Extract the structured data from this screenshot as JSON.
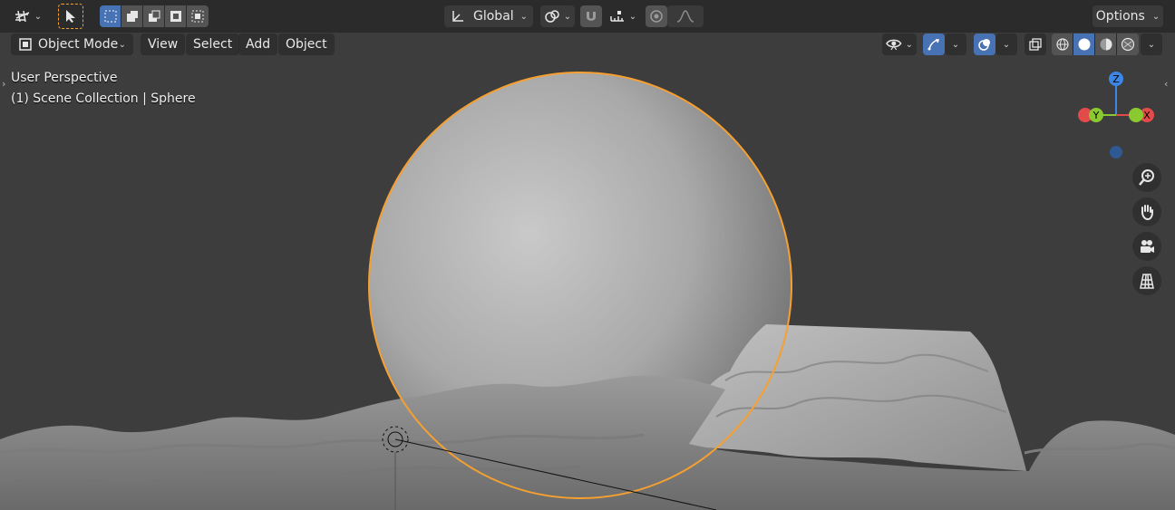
{
  "header": {
    "transform_orientation": "Global",
    "options_label": "Options"
  },
  "menubar": {
    "mode_label": "Object Mode",
    "menus": [
      "View",
      "Select",
      "Add",
      "Object"
    ]
  },
  "viewport": {
    "perspective_label": "User Perspective",
    "collection_label": "(1) Scene Collection | Sphere"
  },
  "gizmo": {
    "z_label": "Z",
    "y_label": "Y",
    "x_label": "X",
    "x_color": "#e34a4a",
    "y_color": "#8bc931",
    "z_color": "#3c87e6"
  },
  "colors": {
    "accent": "#4772b3",
    "selection_outline": "#f5a030",
    "viewport_bg": "#3d3d3d",
    "header_bg": "#2b2b2b"
  }
}
